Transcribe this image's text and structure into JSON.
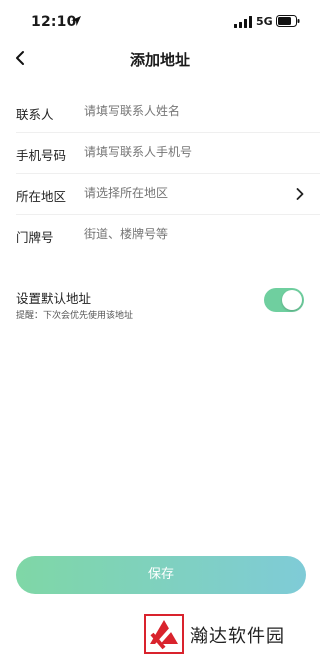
{
  "status": {
    "time": "12:10",
    "network": "5G"
  },
  "nav": {
    "title": "添加地址"
  },
  "form": {
    "rows": [
      {
        "label": "联系人",
        "placeholder": "请填写联系人姓名"
      },
      {
        "label": "手机号码",
        "placeholder": "请填写联系人手机号"
      },
      {
        "label": "所在地区",
        "placeholder": "请选择所在地区"
      },
      {
        "label": "门牌号",
        "placeholder": "街道、楼牌号等"
      }
    ]
  },
  "default_address": {
    "title": "设置默认地址",
    "hint": "提醒：下次会优先使用该地址",
    "enabled": true
  },
  "save_label": "保存",
  "colors": {
    "accent": "#6fcf9f",
    "button_start": "#7fd7a6",
    "button_end": "#7fcbd7"
  },
  "watermark": {
    "text": "瀚达软件园"
  }
}
